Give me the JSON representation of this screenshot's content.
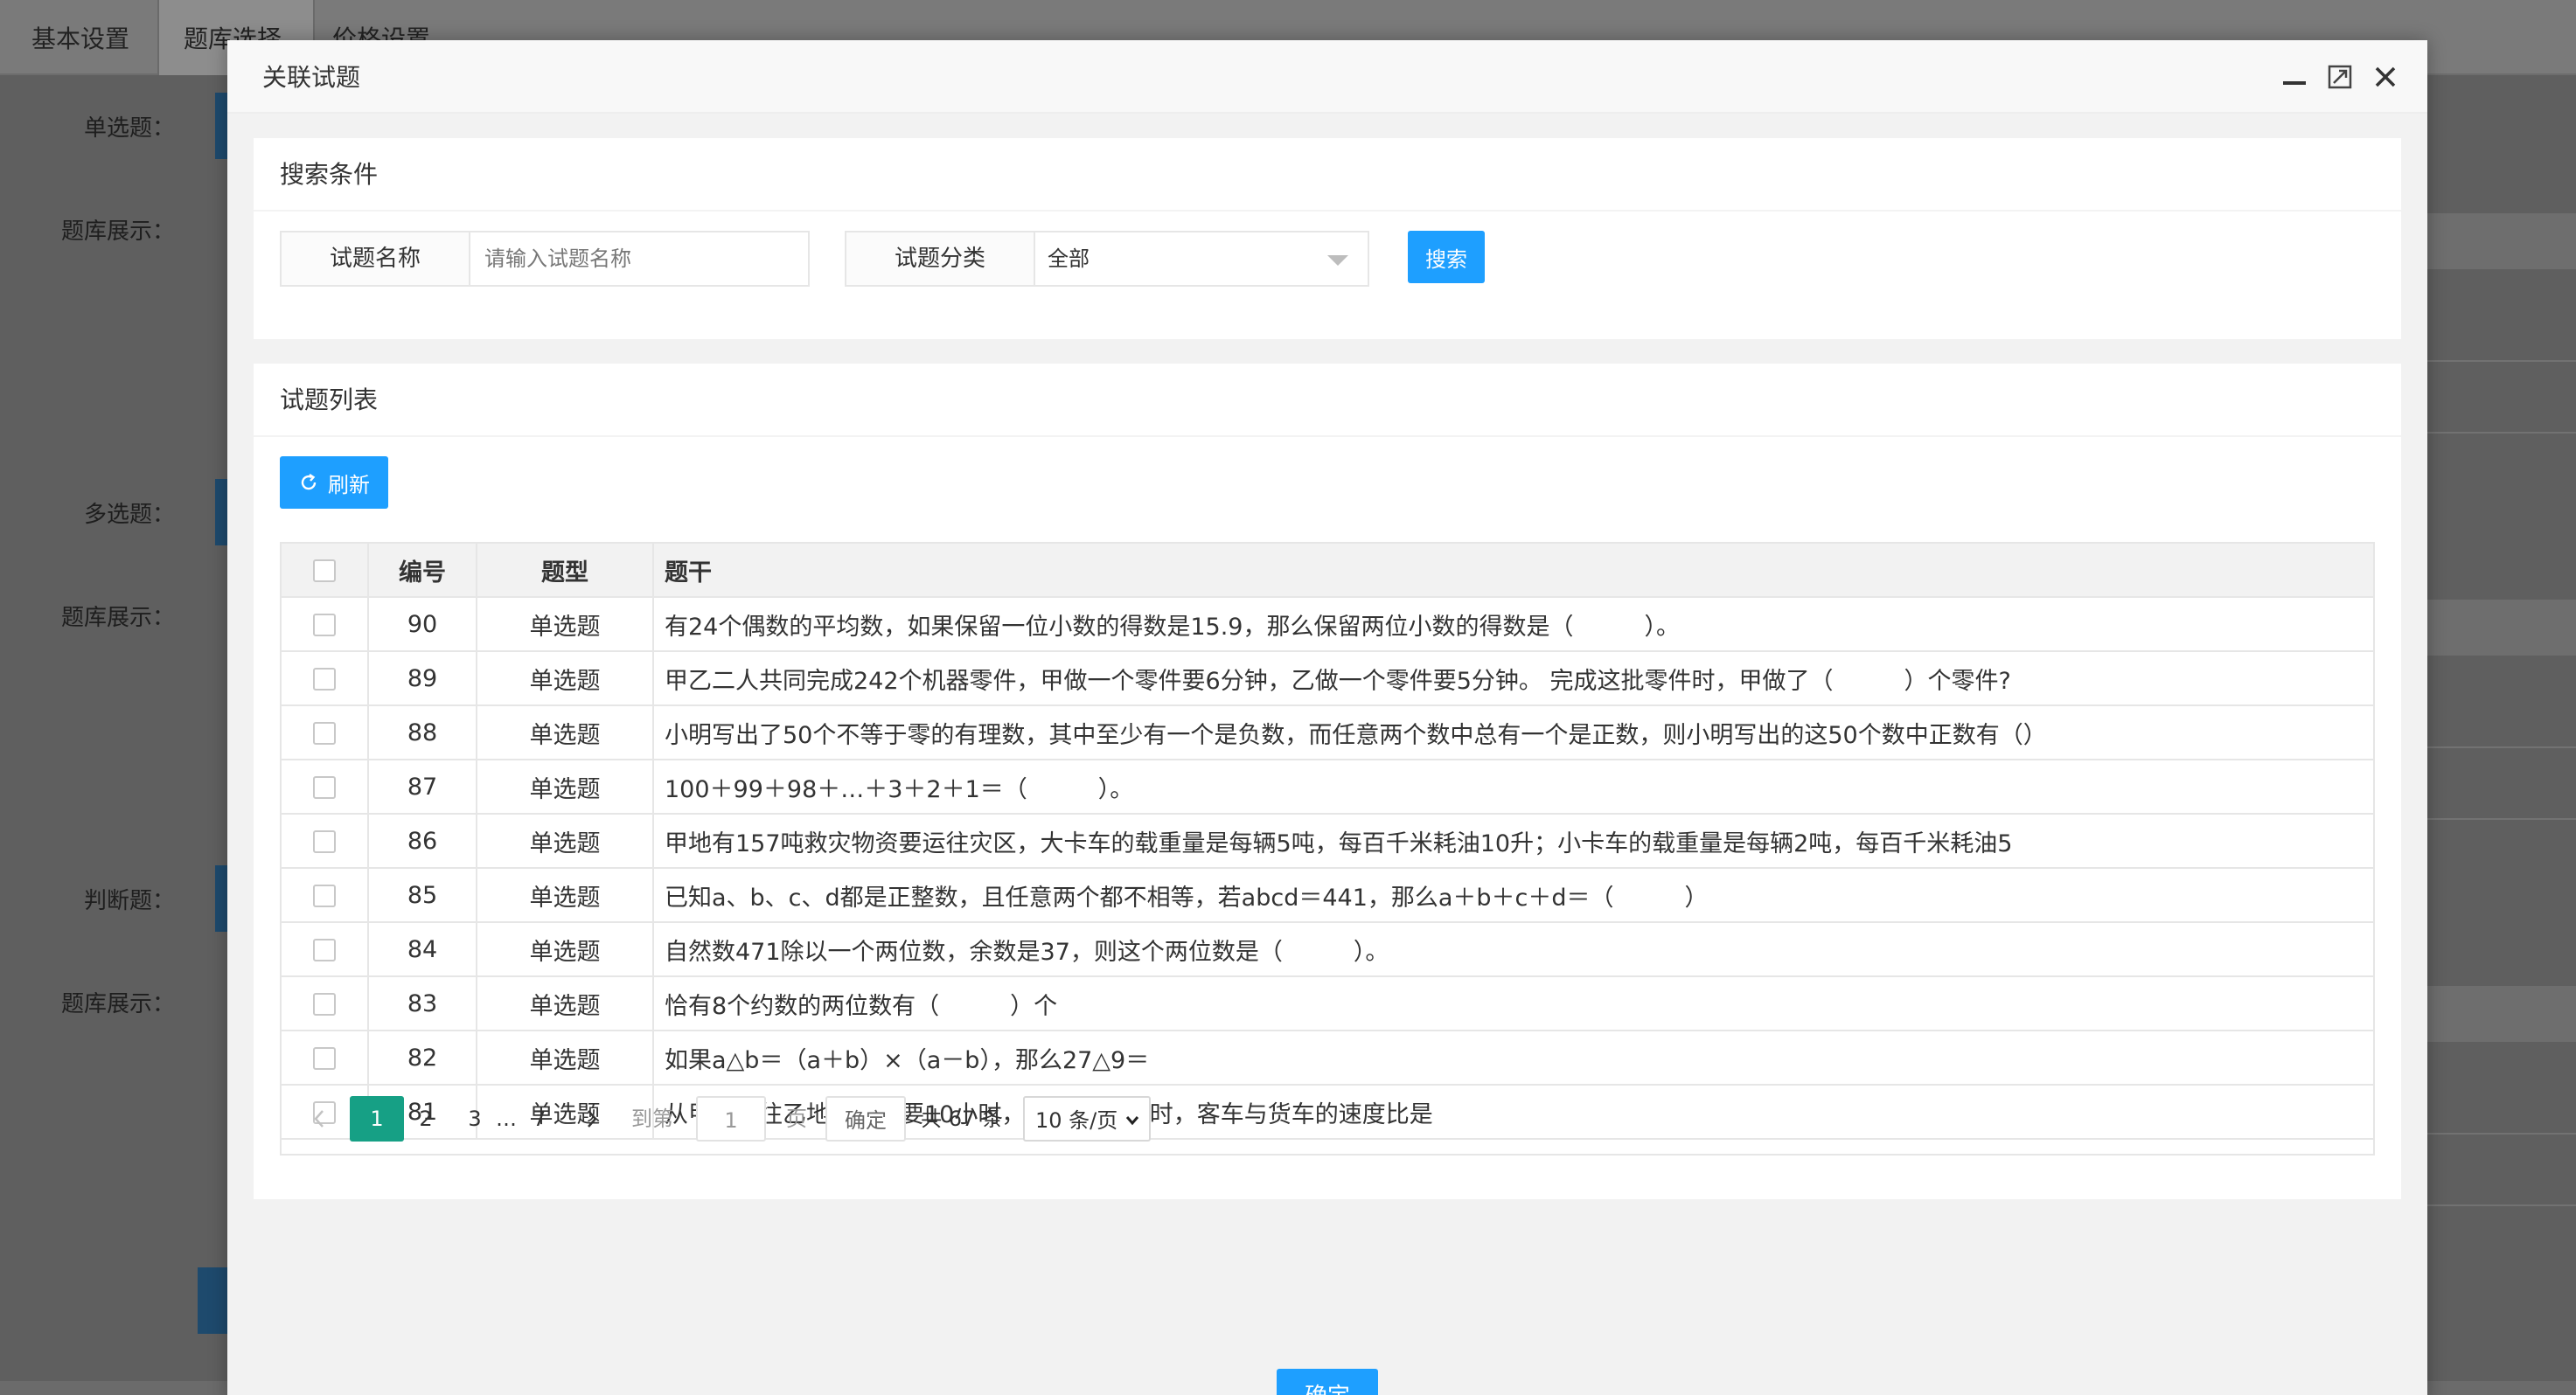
{
  "background": {
    "tabs": [
      "基本设置",
      "题库选择",
      "价格设置"
    ],
    "labels": [
      "单选题：",
      "题库展示：",
      "多选题：",
      "题库展示：",
      "判断题：",
      "题库展示："
    ]
  },
  "modal": {
    "title": "关联试题",
    "search": {
      "heading": "搜索条件",
      "name_label": "试题名称",
      "name_placeholder": "请输入试题名称",
      "category_label": "试题分类",
      "category_value": "全部",
      "search_button": "搜索"
    },
    "list": {
      "heading": "试题列表",
      "refresh_button": "刷新",
      "columns": [
        "编号",
        "题型",
        "题干"
      ],
      "rows": [
        {
          "id": "90",
          "type": "单选题",
          "stem": "有24个偶数的平均数，如果保留一位小数的得数是15.9，那么保留两位小数的得数是（　　　）。"
        },
        {
          "id": "89",
          "type": "单选题",
          "stem": "甲乙二人共同完成242个机器零件，甲做一个零件要6分钟，乙做一个零件要5分钟。 完成这批零件时，甲做了（　　　）个零件?"
        },
        {
          "id": "88",
          "type": "单选题",
          "stem": "小明写出了50个不等于零的有理数，其中至少有一个是负数，而任意两个数中总有一个是正数，则小明写出的这50个数中正数有（）"
        },
        {
          "id": "87",
          "type": "单选题",
          "stem": "100＋99＋98＋…＋3＋2＋1＝（　　　）。"
        },
        {
          "id": "86",
          "type": "单选题",
          "stem": "甲地有157吨救灾物资要运往灾区，大卡车的载重量是每辆5吨，每百千米耗油10升；小卡车的载重量是每辆2吨，每百千米耗油5"
        },
        {
          "id": "85",
          "type": "单选题",
          "stem": "已知a、b、c、d都是正整数，且任意两个都不相等，若abcd＝441，那么a＋b＋c＋d＝（　　　）"
        },
        {
          "id": "84",
          "type": "单选题",
          "stem": "自然数471除以一个两位数，余数是37，则这个两位数是（　　　）。"
        },
        {
          "id": "83",
          "type": "单选题",
          "stem": "恰有8个约数的两位数有（　　　）个"
        },
        {
          "id": "82",
          "type": "单选题",
          "stem": "如果a△b＝（a＋b）×（a－b），那么27△9＝"
        },
        {
          "id": "81",
          "type": "单选题",
          "stem": "从甲地开往乙地，客车要10小时，货车要15小时，客车与货车的速度比是"
        }
      ]
    },
    "pager": {
      "pages": [
        "1",
        "2",
        "3",
        "…",
        "7"
      ],
      "current": "1",
      "goto_label": "到第",
      "goto_value": "1",
      "page_unit": "页",
      "confirm": "确定",
      "total": "共 67 条",
      "page_size": "10 条/页"
    },
    "footer_button": "确定"
  }
}
